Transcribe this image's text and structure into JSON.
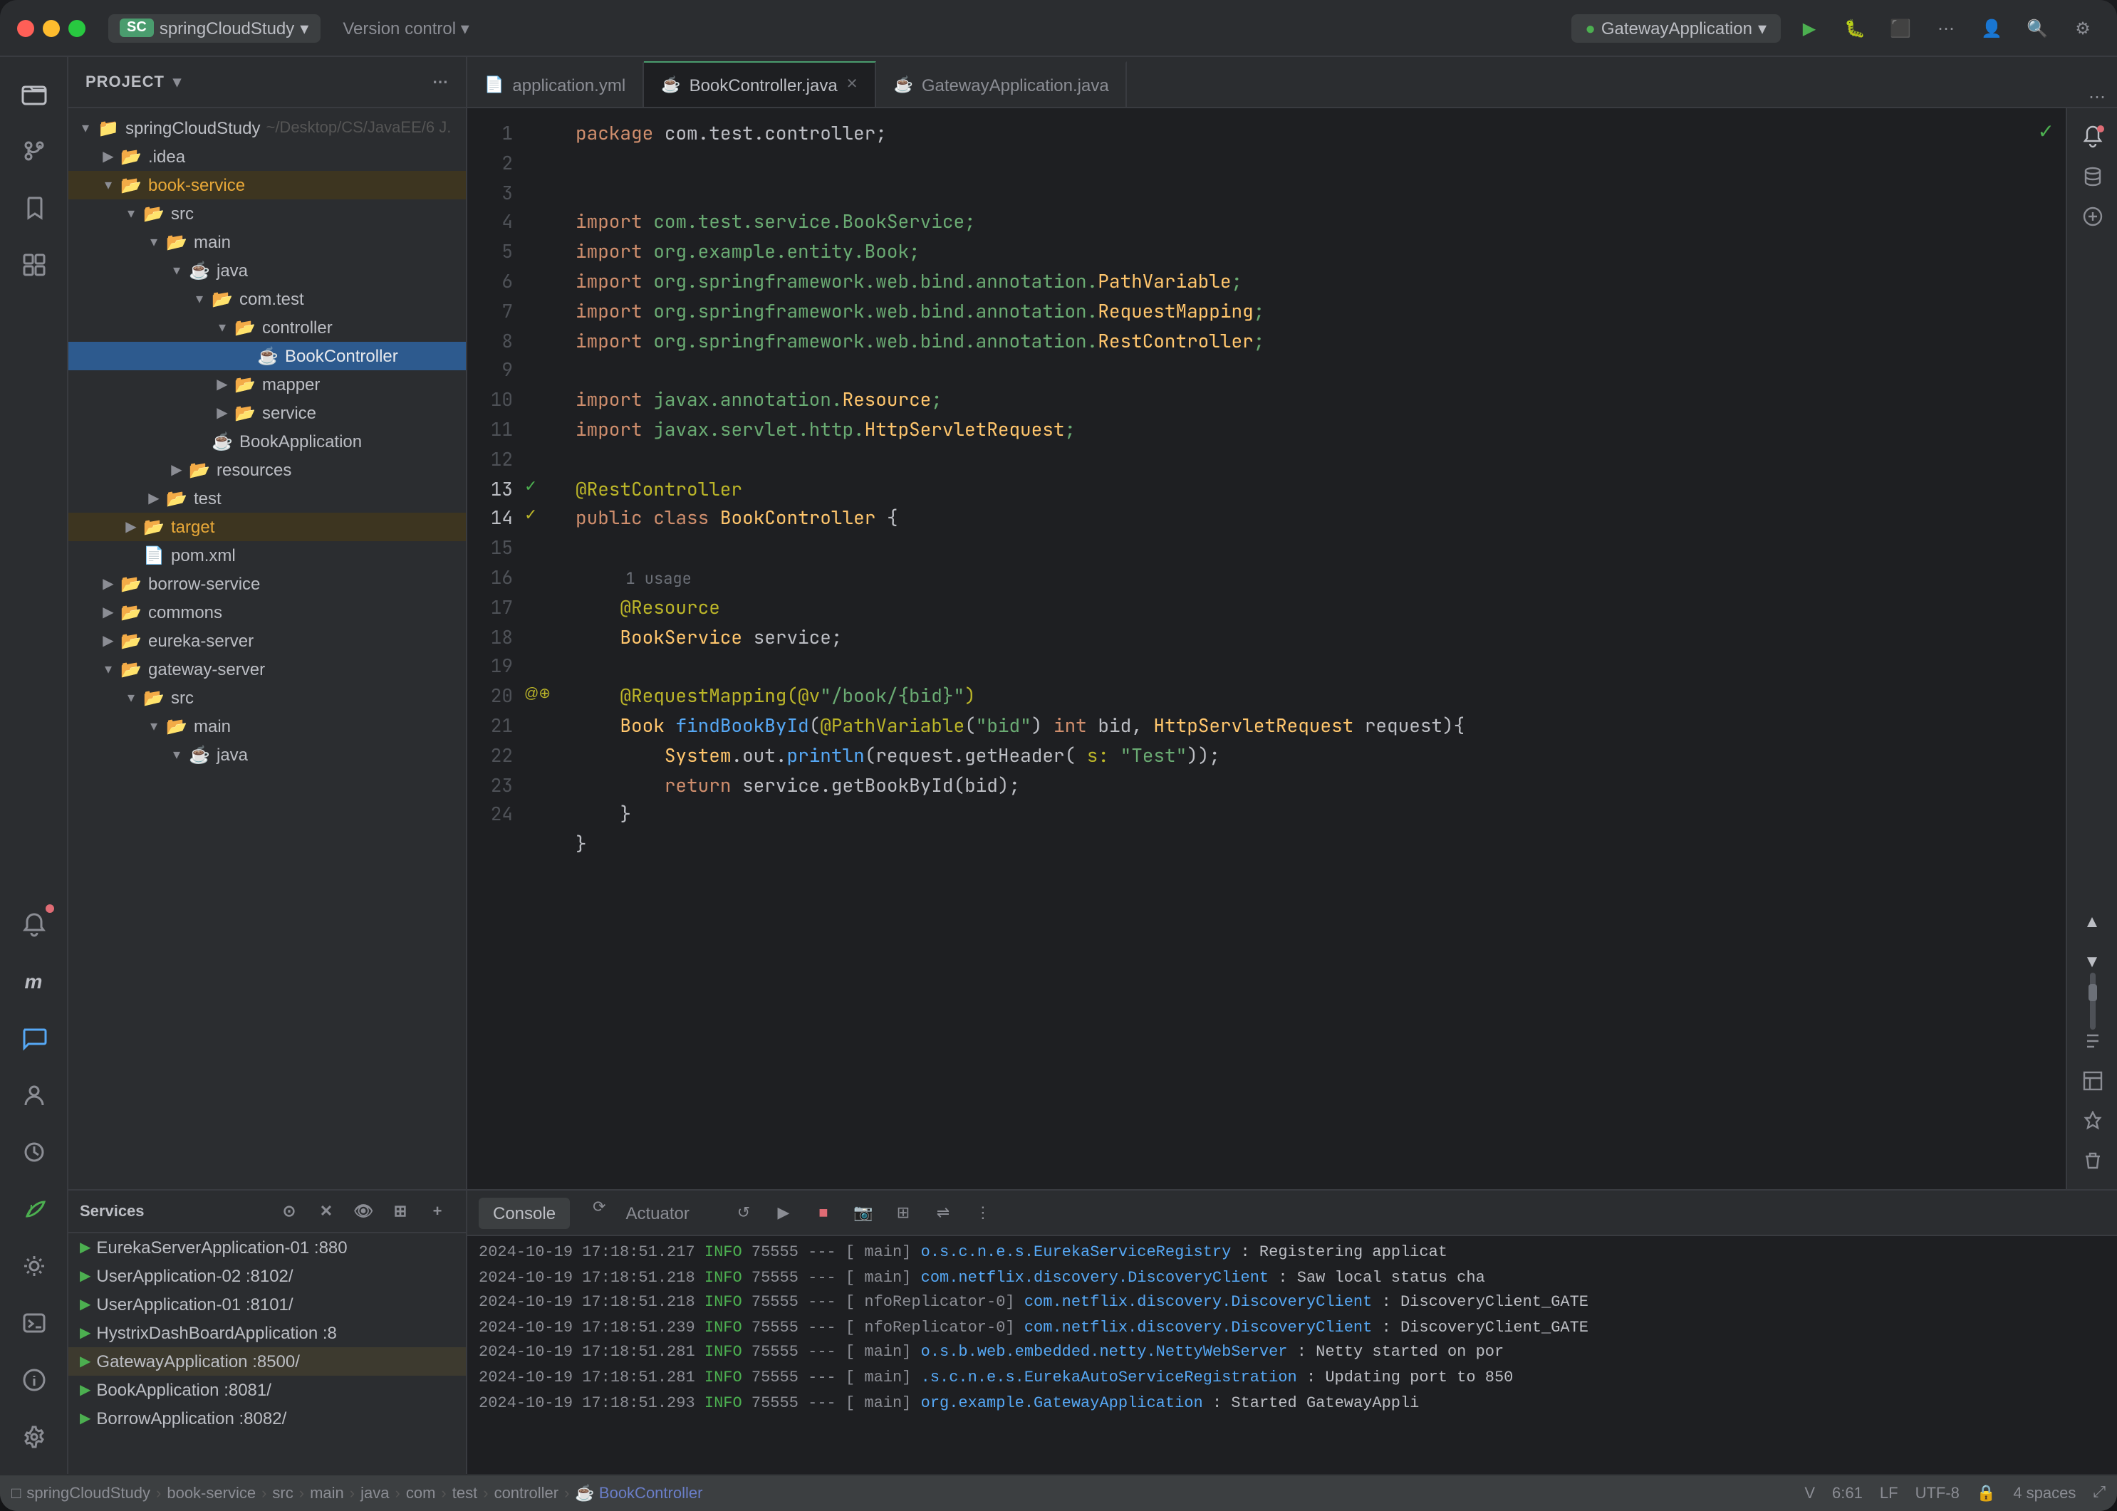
{
  "window": {
    "title": "springCloudStudy"
  },
  "titlebar": {
    "project_badge": "SC",
    "project_name": "springCloudStudy",
    "project_path": "~/Desktop/CS/JavaEE/6 J...",
    "version_control": "Version control",
    "run_config": "GatewayApplication"
  },
  "tabs": [
    {
      "label": "application.yml",
      "icon": "📄",
      "active": false,
      "closable": false
    },
    {
      "label": "BookController.java",
      "icon": "☕",
      "active": true,
      "closable": true
    },
    {
      "label": "GatewayApplication.java",
      "icon": "☕",
      "active": false,
      "closable": false
    }
  ],
  "sidebar": {
    "header": "Project",
    "tree": [
      {
        "level": 0,
        "label": "springCloudStudy",
        "extra": "~/Desktop/CS/JavaEE/6 J.",
        "type": "folder",
        "open": true
      },
      {
        "level": 1,
        "label": ".idea",
        "type": "folder",
        "open": false
      },
      {
        "level": 1,
        "label": "book-service",
        "type": "folder",
        "open": true,
        "highlight": true
      },
      {
        "level": 2,
        "label": "src",
        "type": "folder",
        "open": true
      },
      {
        "level": 3,
        "label": "main",
        "type": "folder",
        "open": true
      },
      {
        "level": 4,
        "label": "java",
        "type": "folder",
        "open": true
      },
      {
        "level": 5,
        "label": "com.test",
        "type": "folder",
        "open": true
      },
      {
        "level": 6,
        "label": "controller",
        "type": "folder",
        "open": true
      },
      {
        "level": 7,
        "label": "BookController",
        "type": "java",
        "selected": true
      },
      {
        "level": 6,
        "label": "mapper",
        "type": "folder",
        "open": false
      },
      {
        "level": 6,
        "label": "service",
        "type": "folder",
        "open": false
      },
      {
        "level": 5,
        "label": "BookApplication",
        "type": "java-app"
      },
      {
        "level": 4,
        "label": "resources",
        "type": "folder",
        "open": false
      },
      {
        "level": 3,
        "label": "test",
        "type": "folder",
        "open": false
      },
      {
        "level": 2,
        "label": "target",
        "type": "folder",
        "open": false,
        "highlight": true
      },
      {
        "level": 2,
        "label": "pom.xml",
        "type": "xml"
      },
      {
        "level": 1,
        "label": "borrow-service",
        "type": "folder",
        "open": false
      },
      {
        "level": 1,
        "label": "commons",
        "type": "folder",
        "open": false
      },
      {
        "level": 1,
        "label": "eureka-server",
        "type": "folder",
        "open": false
      },
      {
        "level": 1,
        "label": "gateway-server",
        "type": "folder",
        "open": true
      },
      {
        "level": 2,
        "label": "src",
        "type": "folder",
        "open": true
      },
      {
        "level": 3,
        "label": "main",
        "type": "folder",
        "open": true
      },
      {
        "level": 4,
        "label": "java",
        "type": "folder",
        "open": true
      }
    ]
  },
  "services": {
    "header": "Services",
    "items": [
      {
        "label": "EurekaServerApplication-01 :880",
        "port": ":880",
        "running": true
      },
      {
        "label": "UserApplication-02 :8102/",
        "port": ":8102/",
        "running": true
      },
      {
        "label": "UserApplication-01 :8101/",
        "port": ":8101/",
        "running": true
      },
      {
        "label": "HystrixDashBoardApplication :8",
        "port": ":8",
        "running": true
      },
      {
        "label": "GatewayApplication :8500/",
        "port": ":8500/",
        "running": true,
        "active": true
      },
      {
        "label": "BookApplication :8081/",
        "port": ":8081/",
        "running": true
      },
      {
        "label": "BorrowApplication :8082/",
        "port": ":8082/",
        "running": true
      }
    ]
  },
  "code": {
    "lines": [
      {
        "n": 1,
        "content": "package_com.test.controller;"
      },
      {
        "n": 2,
        "content": ""
      },
      {
        "n": 3,
        "content": ""
      },
      {
        "n": 4,
        "content": "import_com.test.service.BookService;"
      },
      {
        "n": 5,
        "content": "import_org.example.entity.Book;"
      },
      {
        "n": 6,
        "content": "import_org.springframework.web.bind.annotation.PathVariable;"
      },
      {
        "n": 7,
        "content": "import_org.springframework.web.bind.annotation.RequestMapping;"
      },
      {
        "n": 8,
        "content": "import_org.springframework.web.bind.annotation.RestController;"
      },
      {
        "n": 9,
        "content": ""
      },
      {
        "n": 10,
        "content": "import_javax.annotation.Resource;"
      },
      {
        "n": 11,
        "content": "import_javax.servlet.http.HttpServletRequest;"
      },
      {
        "n": 12,
        "content": ""
      },
      {
        "n": 13,
        "content": "@RestController"
      },
      {
        "n": 14,
        "content": "public_class_BookController_{"
      },
      {
        "n": 15,
        "content": ""
      },
      {
        "n": 16,
        "content": "    @Resource"
      },
      {
        "n": 17,
        "content": "    BookService_service;"
      },
      {
        "n": 18,
        "content": ""
      },
      {
        "n": 19,
        "content": "    @RequestMapping(@v\"/book/{bid}\")"
      },
      {
        "n": 20,
        "content": "    Book_findBookById(@PathVariable(\"bid\")_int_bid,_HttpServletRequest_request){"
      },
      {
        "n": 21,
        "content": "        System.out.println(request.getHeader(_s:_\"Test\"));"
      },
      {
        "n": 22,
        "content": "        return_service.getBookById(bid);"
      },
      {
        "n": 23,
        "content": "    }"
      },
      {
        "n": 24,
        "content": "}"
      }
    ]
  },
  "console": {
    "tabs": [
      "Console",
      "Actuator"
    ],
    "logs": [
      {
        "time": "2024-10-19 17:18:51.217",
        "level": "INFO",
        "port": "75555",
        "thread": "main",
        "class": "o.s.c.n.e.s.EurekaServiceRegistry",
        "msg": ": Registering applicat"
      },
      {
        "time": "2024-10-19 17:18:51.218",
        "level": "INFO",
        "port": "75555",
        "thread": "main",
        "class": "com.netflix.discovery.DiscoveryClient",
        "msg": ": Saw local status cha"
      },
      {
        "time": "2024-10-19 17:18:51.218",
        "level": "INFO",
        "port": "75555",
        "thread": "nfoReplicator-0",
        "class": "com.netflix.discovery.DiscoveryClient",
        "msg": ": DiscoveryClient_GATE"
      },
      {
        "time": "2024-10-19 17:18:51.239",
        "level": "INFO",
        "port": "75555",
        "thread": "nfoReplicator-0",
        "class": "com.netflix.discovery.DiscoveryClient",
        "msg": ": DiscoveryClient_GATE"
      },
      {
        "time": "2024-10-19 17:18:51.281",
        "level": "INFO",
        "port": "75555",
        "thread": "main",
        "class": "o.s.b.web.embedded.netty.NettyWebServer",
        "msg": ": Netty started on por"
      },
      {
        "time": "2024-10-19 17:18:51.281",
        "level": "INFO",
        "port": "75555",
        "thread": "main",
        "class": ".s.c.n.e.s.EurekaAutoServiceRegistration",
        "msg": ": Updating port to 850"
      },
      {
        "time": "2024-10-19 17:18:51.293",
        "level": "INFO",
        "port": "75555",
        "thread": "main",
        "class": "org.example.GatewayApplication",
        "msg": ": Started GatewayAppli"
      }
    ]
  },
  "statusbar": {
    "breadcrumbs": [
      "springCloudStudy",
      "book-service",
      "src",
      "main",
      "java",
      "com",
      "test",
      "controller",
      "BookController"
    ],
    "branch": "V",
    "position": "6:61",
    "encoding": "LF",
    "charset": "UTF-8",
    "indent": "4 spaces"
  }
}
